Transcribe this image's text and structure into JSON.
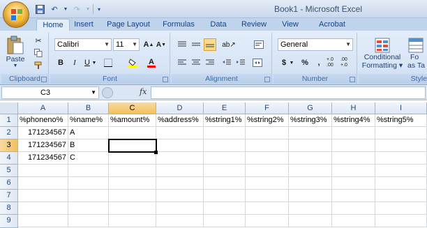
{
  "app": {
    "title": "Book1 - Microsoft Excel"
  },
  "tabs": [
    "Home",
    "Insert",
    "Page Layout",
    "Formulas",
    "Data",
    "Review",
    "View",
    "Acrobat"
  ],
  "ribbon": {
    "clipboard": {
      "paste_label": "Paste",
      "group_label": "Clipboard"
    },
    "font": {
      "family": "Calibri",
      "size": "11",
      "group_label": "Font"
    },
    "alignment": {
      "group_label": "Alignment"
    },
    "number": {
      "format": "General",
      "currency_symbol": "$",
      "percent_symbol": "%",
      "comma_symbol": ",",
      "increase_decimal": "+.0 .00",
      "decrease_decimal": ".00 +.0",
      "group_label": "Number"
    },
    "styles": {
      "conditional_formatting_label": "Conditional",
      "conditional_formatting_label2": "Formatting",
      "format_as_table_label": "Fo",
      "format_as_table_label2": "as Ta",
      "group_label": "Style"
    }
  },
  "formula_bar": {
    "name_box": "C3",
    "fx_label": "fx",
    "formula": ""
  },
  "sheet": {
    "columns": [
      "A",
      "B",
      "C",
      "D",
      "E",
      "F",
      "G",
      "H",
      "I"
    ],
    "rows": [
      "1",
      "2",
      "3",
      "4",
      "5",
      "6",
      "7",
      "8",
      "9"
    ],
    "selected_column": "C",
    "selected_row": "3",
    "cells": {
      "A1": "%phoneno%",
      "B1": "%name%",
      "C1": "%amount%",
      "D1": "%address%",
      "E1": "%string1%",
      "F1": "%string2%",
      "G1": "%string3%",
      "H1": "%string4%",
      "I1": "%string5%",
      "A2": "171234567",
      "B2": "A",
      "A3": "171234567",
      "B3": "B",
      "A4": "171234567",
      "B4": "C"
    }
  },
  "colors": {
    "ribbon_bg": "#d7e4f5",
    "selection_header": "#f1c15f",
    "grid_line": "#d0d7e5"
  }
}
